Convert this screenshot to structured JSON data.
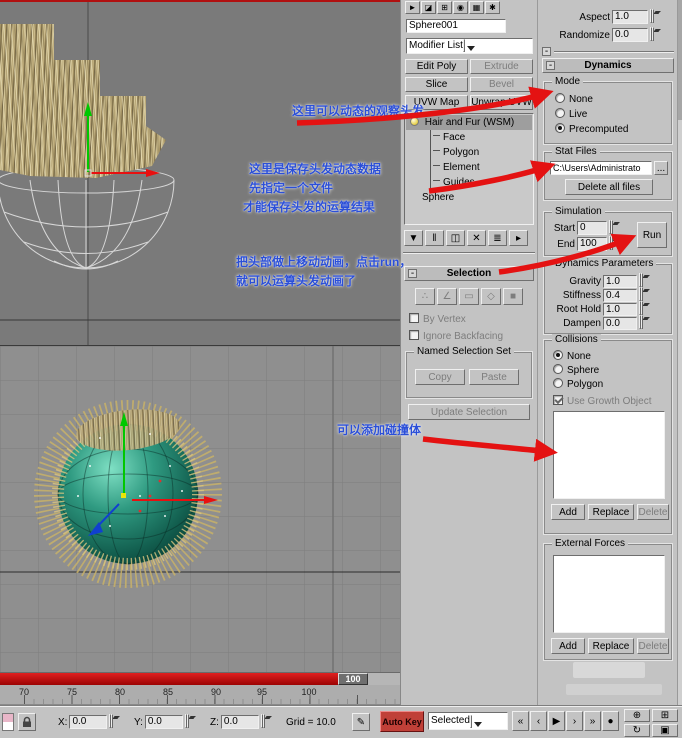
{
  "command_panel": {
    "tabs": [
      {
        "name": "create",
        "glyph": "►"
      },
      {
        "name": "modify",
        "glyph": "◪"
      },
      {
        "name": "hierarchy",
        "glyph": "⊞"
      },
      {
        "name": "motion",
        "glyph": "◉"
      },
      {
        "name": "display",
        "glyph": "▦"
      },
      {
        "name": "utilities",
        "glyph": "✱"
      }
    ],
    "object_name": "Sphere001",
    "modifier_list_label": "Modifier List",
    "modifier_buttons": {
      "edit_poly": "Edit Poly",
      "extrude": "Extrude",
      "slice": "Slice",
      "bevel": "Bevel",
      "uvw_map": "UVW Map",
      "unwrap_uvw": "Unwrap UVW"
    },
    "stack": {
      "modifier": "Hair and Fur (WSM)",
      "children": [
        "Face",
        "Polygon",
        "Element",
        "Guides"
      ],
      "base_object": "Sphere"
    },
    "selection": {
      "title": "Selection",
      "by_vertex": "By Vertex",
      "ignore_backfacing": "Ignore Backfacing",
      "named_set_title": "Named Selection Set",
      "copy": "Copy",
      "paste": "Paste",
      "update": "Update Selection"
    }
  },
  "hair_panel": {
    "aspect_label": "Aspect",
    "aspect_value": "1.0",
    "randomize_label": "Randomize",
    "randomize_value": "0.0",
    "dynamics_title": "Dynamics",
    "mode": {
      "title": "Mode",
      "options": [
        "None",
        "Live",
        "Precomputed"
      ],
      "selected": "Precomputed"
    },
    "stat_files": {
      "title": "Stat Files",
      "path": "C:\\Users\\Administrato",
      "browse": "...",
      "delete_all": "Delete all files"
    },
    "simulation": {
      "title": "Simulation",
      "start_label": "Start",
      "start_value": "0",
      "end_label": "End",
      "end_value": "100",
      "run_label": "Run"
    },
    "dynamics_parameters": {
      "title": "Dynamics Parameters",
      "rows": [
        {
          "label": "Gravity",
          "value": "1.0"
        },
        {
          "label": "Stiffness",
          "value": "0.4"
        },
        {
          "label": "Root Hold",
          "value": "1.0"
        },
        {
          "label": "Dampen",
          "value": "0.0"
        }
      ]
    },
    "collisions": {
      "title": "Collisions",
      "options": [
        "None",
        "Sphere",
        "Polygon"
      ],
      "selected": "None",
      "use_growth_object": "Use Growth Object",
      "add": "Add",
      "replace": "Replace",
      "delete": "Delete"
    },
    "external_forces": {
      "title": "External Forces",
      "add": "Add",
      "replace": "Replace",
      "delete": "Delete"
    }
  },
  "annotations": {
    "observe": "这里可以动态的观察头发",
    "save1": "这里是保存头发动态数据",
    "save2": "先指定一个文件",
    "save3": "才能保存头发的运算结果",
    "run1": "把头部做上移动动画，点击run，",
    "run2": "就可以运算头发动画了",
    "collision": "可以添加碰撞体"
  },
  "timeline": {
    "ticks": [
      "70",
      "75",
      "80",
      "85",
      "90",
      "95",
      "100"
    ],
    "current_frame": "100"
  },
  "status_bar": {
    "x_label": "X:",
    "x_value": "0.0",
    "y_label": "Y:",
    "y_value": "0.0",
    "z_label": "Z:",
    "z_value": "0.0",
    "grid_label": "Grid = 10.0",
    "auto_key": "Auto Key",
    "selection_set": "Selected"
  },
  "icons": {
    "minus": "-",
    "pen": "✎",
    "stack_tools": [
      {
        "name": "pin-stack",
        "glyph": "▼"
      },
      {
        "name": "show-end-result",
        "glyph": "‖"
      },
      {
        "name": "make-unique",
        "glyph": "◫"
      },
      {
        "name": "remove-modifier",
        "glyph": "✕"
      },
      {
        "name": "configure-modifier-sets",
        "glyph": "≣"
      },
      {
        "name": "stack-options",
        "glyph": "▸"
      }
    ],
    "subobject": [
      "∴",
      "∠",
      "▭",
      "◇",
      "■"
    ],
    "playback": [
      "«",
      "‹",
      "▶",
      "›",
      "»",
      "●"
    ],
    "nav": [
      "⊕",
      "⊞",
      "↻",
      "▣"
    ]
  },
  "colors": {
    "accent_red": "#e41212",
    "annotation_blue": "#2b4fd8",
    "autokey_red": "#c04038",
    "hair_tan": "#c9ba8c",
    "sphere_teal": "#2f9a81"
  }
}
